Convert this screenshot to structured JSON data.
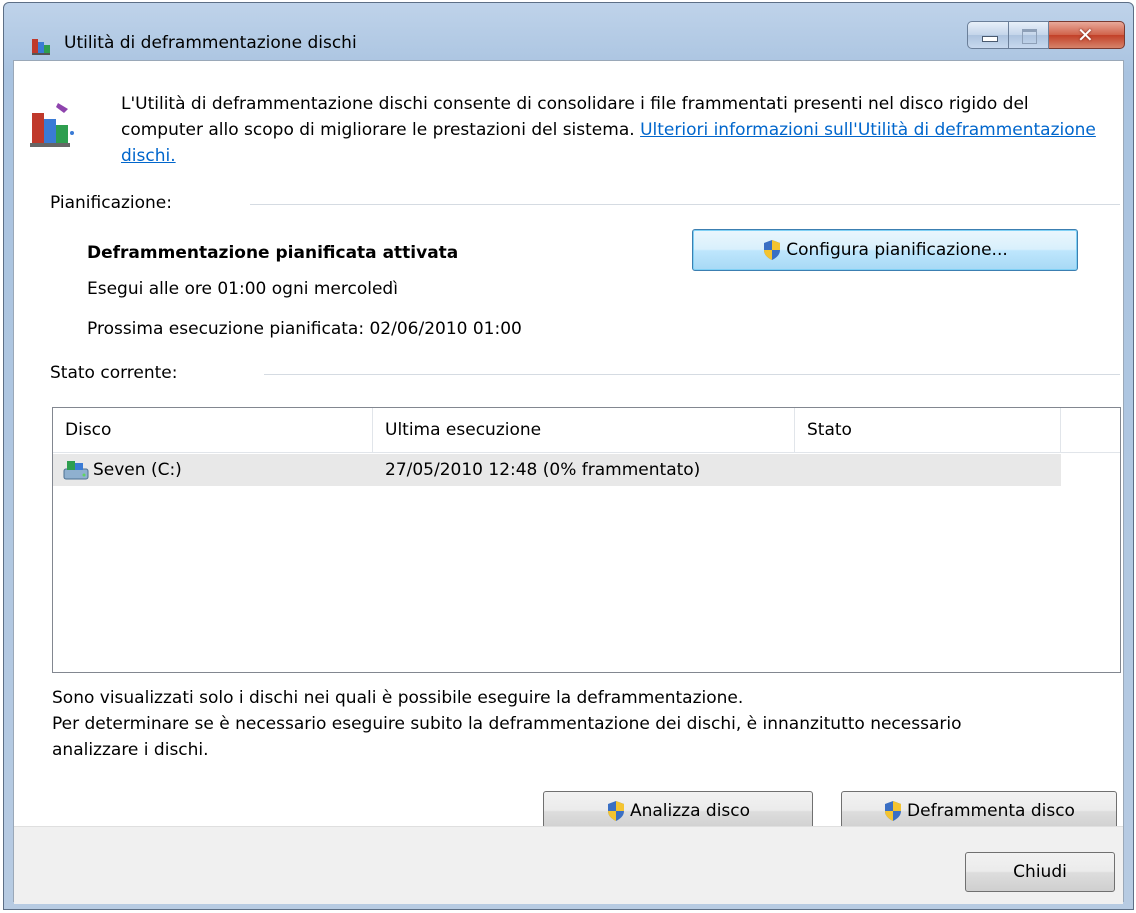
{
  "window": {
    "title": "Utilità di deframmentazione dischi"
  },
  "intro": {
    "text": "L'Utilità di deframmentazione dischi consente di consolidare i file frammentati presenti nel disco rigido del computer allo scopo di migliorare le prestazioni del sistema. ",
    "link": "Ulteriori informazioni sull'Utilità di deframmentazione dischi."
  },
  "schedule": {
    "group_label": "Pianificazione:",
    "status_title": "Deframmentazione pianificata attivata",
    "run_line": "Esegui alle ore 01:00 ogni mercoledì",
    "next_run": "Prossima esecuzione pianificata: 02/06/2010 01:00",
    "configure_button": "Configura pianificazione..."
  },
  "current_status": {
    "group_label": "Stato corrente:",
    "columns": [
      "Disco",
      "Ultima esecuzione",
      "Stato"
    ],
    "rows": [
      {
        "disk": "Seven (C:)",
        "last_run": "27/05/2010 12:48 (0% frammentato)",
        "status": ""
      }
    ]
  },
  "notes": {
    "line1": "Sono visualizzati solo i dischi nei quali è possibile eseguire la deframmentazione.",
    "line2": "Per determinare se è necessario eseguire subito la deframmentazione dei dischi, è innanzitutto necessario analizzare i dischi."
  },
  "actions": {
    "analyze_button": "Analizza disco",
    "defrag_button": "Deframmenta disco",
    "close_button": "Chiudi"
  },
  "colors": {
    "link": "#0066cc",
    "selected_row": "#e8e8e8",
    "title_bar": "#a9c3e0"
  },
  "icons": [
    "defrag-app-icon",
    "minimize-icon",
    "maximize-icon",
    "close-icon",
    "defrag-large-icon",
    "uac-shield-icon",
    "drive-icon"
  ]
}
